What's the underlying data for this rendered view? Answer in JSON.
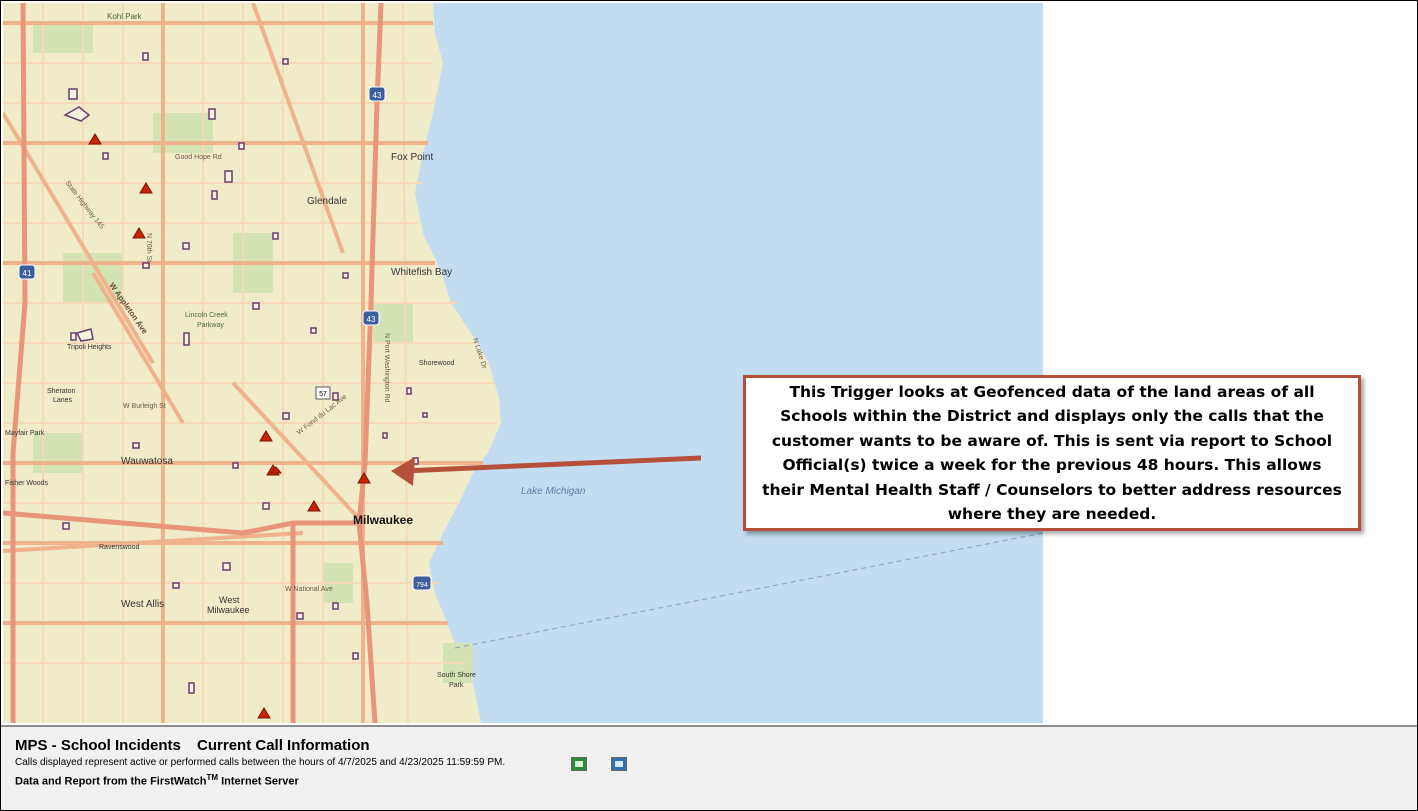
{
  "map": {
    "colors": {
      "land": "#f0ebc9",
      "water": "#c2dcf1",
      "major_road": "#f0b28d",
      "minor_road": "#f6d9b8",
      "park": "#d4e3b4",
      "school_outline": "#6a3d6e",
      "incident_marker": "#cc2200",
      "callout_border": "#b5503b",
      "arrow": "#b5503b"
    },
    "labels": {
      "kohl_park": "Kohl Park",
      "good_hope": "Good Hope Rd",
      "fox_point": "Fox Point",
      "glendale": "Glendale",
      "whitefish_bay": "Whitefish Bay",
      "hwy_145": "State Highway 145",
      "w_appleton": "W Appleton Ave",
      "lincoln_creek": "Lincoln Creek",
      "parkway": "Parkway",
      "tripoli": "Tripoli Heights",
      "sheraton": "Sheraton",
      "lanes": "Lanes",
      "mayfair": "Mayfair Park",
      "fisher_woods": "Fisher Woods",
      "wauwatosa": "Wauwatosa",
      "burleigh": "W Burleigh St",
      "fond_du_lac": "W Fond du Lac Ave",
      "shorewood": "Shorewood",
      "lake_michigan": "Lake Michigan",
      "milwaukee": "Milwaukee",
      "ravenswood": "Ravenswood",
      "west_allis": "West Allis",
      "west_milwaukee_1": "West",
      "west_milwaukee_2": "Milwaukee",
      "w_national": "W National Ave",
      "south_shore": "South Shore",
      "south_shore_park": "Park",
      "n_lake_dr": "N Lake Dr",
      "n_76th": "N 76th St",
      "n_port_wash": "N Port Washington Rd"
    },
    "shields": {
      "i43_north": "43",
      "i43_mid": "43",
      "i41": "41",
      "us57": "57",
      "i794": "794"
    }
  },
  "callout": {
    "text": "This Trigger looks at Geofenced data of the land areas of all Schools within the District and displays only the calls that the customer wants to be aware of. This is sent via report to School Official(s) twice a week for the previous 48 hours. This allows their Mental Health Staff /  Counselors to better address resources where they are needed."
  },
  "footer": {
    "report_name": "MPS - School Incidents",
    "report_title": "Current Call Information",
    "range_prefix": "Calls displayed represent active or performed calls between the hours of ",
    "start": "4/7/2025",
    "range_and": " and ",
    "end": "4/23/2025 11:59:59 PM.",
    "credit_prefix": "Data and Report from the FirstWatch",
    "credit_tm": "TM",
    "credit_suffix": " Internet Server",
    "excel_icon": "excel-export-icon",
    "report_icon": "report-export-icon"
  }
}
